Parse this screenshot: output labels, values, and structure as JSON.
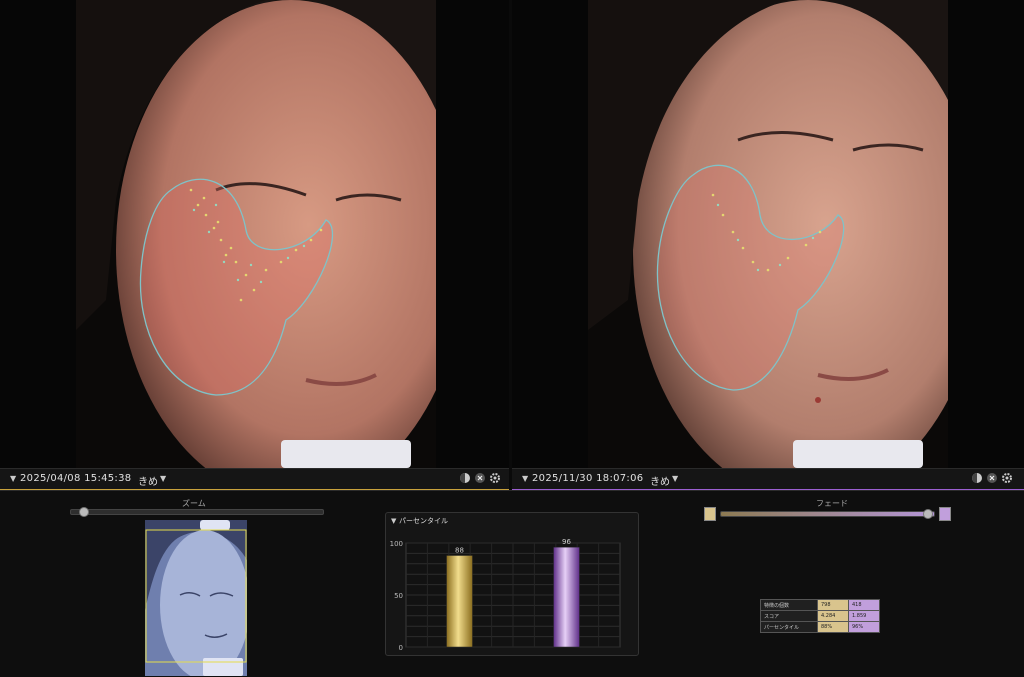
{
  "left": {
    "date": "2025/04/08 15:45:38",
    "name": "きめ",
    "color": "#c9a23c"
  },
  "right": {
    "date": "2025/11/30 18:07:06",
    "name": "きめ",
    "color": "#9b5fd1"
  },
  "zoom": {
    "label": "ズーム"
  },
  "fade": {
    "label": "フェード"
  },
  "percentile_panel": {
    "title": "パーセンタイル"
  },
  "chart_data": {
    "type": "bar",
    "categories": [
      "2025/04/08 15:45:38",
      "2025/11/30 18:07:06"
    ],
    "values": [
      88,
      96
    ],
    "value_labels": [
      "88",
      "96"
    ],
    "ylim": [
      0,
      100
    ],
    "yticks": [
      "0",
      "50",
      "100"
    ],
    "colors": [
      "#c9a23c",
      "#9b5fd1"
    ]
  },
  "stats": {
    "rows": [
      {
        "label": "特徴の個数",
        "a": "798",
        "b": "418"
      },
      {
        "label": "スコア",
        "a": "4.284",
        "b": "1.859"
      },
      {
        "label": "パーセンタイル",
        "a": "88%",
        "b": "96%"
      }
    ]
  }
}
